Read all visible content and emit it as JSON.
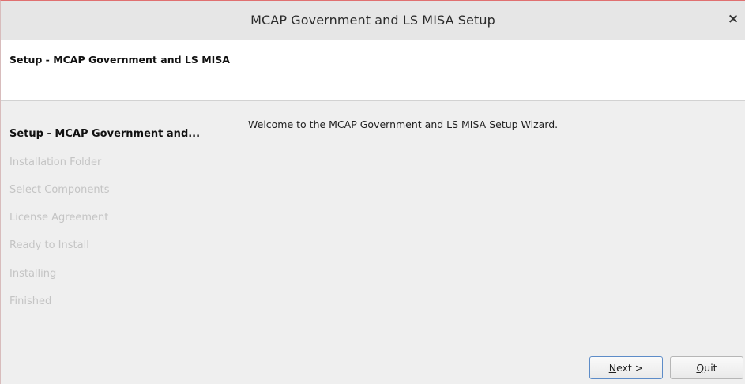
{
  "window": {
    "title": "MCAP Government and LS MISA Setup",
    "close_glyph": "×"
  },
  "header": {
    "heading": "Setup - MCAP Government and LS MISA"
  },
  "steps": [
    {
      "label": "Setup - MCAP Government and...",
      "current": true
    },
    {
      "label": "Installation Folder",
      "current": false
    },
    {
      "label": "Select Components",
      "current": false
    },
    {
      "label": "License Agreement",
      "current": false
    },
    {
      "label": "Ready to Install",
      "current": false
    },
    {
      "label": "Installing",
      "current": false
    },
    {
      "label": "Finished",
      "current": false
    }
  ],
  "main": {
    "welcome_text": "Welcome to the MCAP Government and LS MISA Setup Wizard."
  },
  "buttons": {
    "next": {
      "mnemonic": "N",
      "rest": "ext >"
    },
    "quit": {
      "mnemonic": "Q",
      "rest": "uit"
    }
  },
  "colors": {
    "accent_border": "#5d8cc8",
    "disabled_step": "#c4c4c4"
  }
}
